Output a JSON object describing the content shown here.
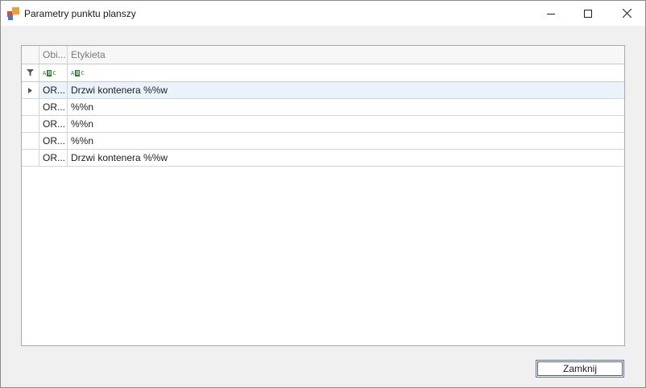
{
  "window": {
    "title": "Parametry punktu planszy",
    "icon": "app-squares-icon",
    "controls": {
      "minimize": "minimize-icon",
      "maximize": "maximize-icon",
      "close": "close-icon"
    }
  },
  "grid": {
    "columns": [
      {
        "label": "Obi..."
      },
      {
        "label": "Etykieta"
      }
    ],
    "filter_row": {
      "icon": "filter-icon",
      "obj_filter_glyph": "ABC",
      "label_filter_glyph": "ABC"
    },
    "rows": [
      {
        "obj": "OR...",
        "label": "Drzwi kontenera %%w",
        "selected": true
      },
      {
        "obj": "OR...",
        "label": "%%n"
      },
      {
        "obj": "OR...",
        "label": "%%n"
      },
      {
        "obj": "OR...",
        "label": "%%n"
      },
      {
        "obj": "OR...",
        "label": "Drzwi kontenera %%w"
      }
    ]
  },
  "buttons": {
    "close_label": "Zamknij"
  },
  "colors": {
    "selected_row": "#eaf3fc",
    "grid_border": "#a9a9a9",
    "filter_text": "#2e7d32"
  }
}
